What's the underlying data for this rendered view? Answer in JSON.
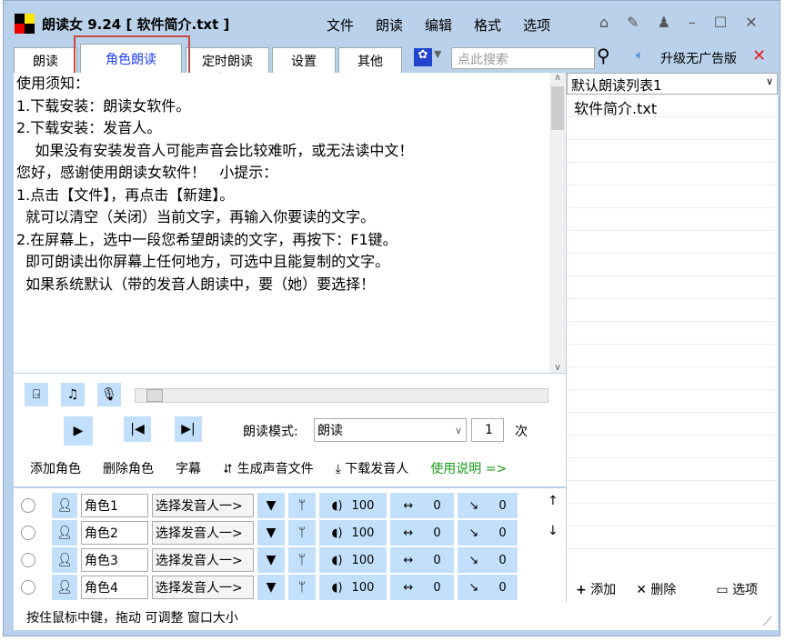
{
  "app": {
    "title": "朗读女 9.24 [ 软件简介.txt ]"
  },
  "menu": [
    "文件",
    "朗读",
    "编辑",
    "格式",
    "选项"
  ],
  "tabs": [
    "朗读",
    "角色朗读",
    "定时朗读",
    "设置",
    "其他"
  ],
  "search": {
    "placeholder": "点此搜索"
  },
  "upgrade": "升级无广告版",
  "text_lines": [
    "使用须知：",
    "1.下载安装：朗读女软件。",
    "2.下载安装：发音人。",
    "    如果没有安装发音人可能声音会比较难听，或无法读中文！",
    "",
    "您好，感谢使用朗读女软件！   小提示：",
    "",
    "1.点击【文件】，再点击【新建】。",
    "  就可以清空（关闭）当前文字，再输入你要读的文字。",
    "",
    "2.在屏幕上，选中一段您希望朗读的文字，再按下：F1键。",
    "  即可朗读出你屏幕上任何地方，可选中且能复制的文字。",
    "",
    "  如果系统默认（带的发音人朗读中，要（她）要选择！"
  ],
  "playlist": {
    "selected": "默认朗读列表1",
    "items": [
      "软件简介.txt"
    ],
    "add": "添加",
    "delete": "删除",
    "options": "选项"
  },
  "controls": {
    "mode_label": "朗读模式:",
    "mode": "朗读",
    "count": "1",
    "count_unit": "次",
    "add_role": "添加角色",
    "delete_role": "删除角色",
    "subtitle": "字幕",
    "gen_audio": "生成声音文件",
    "download_voice": "下载发音人",
    "help": "使用说明 =>"
  },
  "roles": [
    {
      "name": "角色1",
      "voice": "选择发音人一>",
      "volume": "100",
      "speed": "0",
      "pitch": "0"
    },
    {
      "name": "角色2",
      "voice": "选择发音人一>",
      "volume": "100",
      "speed": "0",
      "pitch": "0"
    },
    {
      "name": "角色3",
      "voice": "选择发音人一>",
      "volume": "100",
      "speed": "0",
      "pitch": "0"
    },
    {
      "name": "角色4",
      "voice": "选择发音人一>",
      "volume": "100",
      "speed": "0",
      "pitch": "0"
    }
  ],
  "status": "按住鼠标中键，拖动 可调整 窗口大小"
}
